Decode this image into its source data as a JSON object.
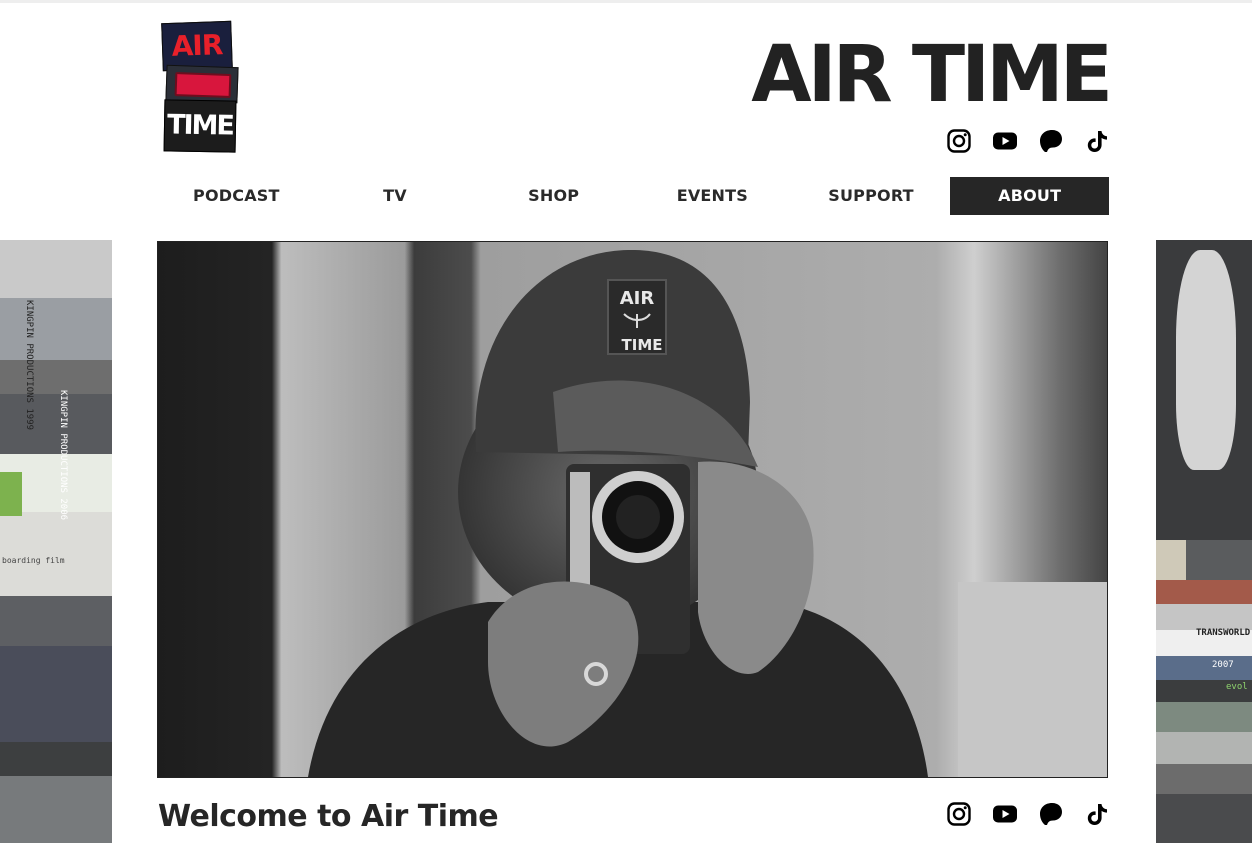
{
  "logo": {
    "line1": "AIR",
    "line2": "TIME"
  },
  "site_title": "AIR TIME",
  "social": [
    {
      "name": "instagram-icon"
    },
    {
      "name": "youtube-icon"
    },
    {
      "name": "patreon-icon"
    },
    {
      "name": "tiktok-icon"
    }
  ],
  "nav": {
    "items": [
      {
        "label": "PODCAST"
      },
      {
        "label": "TV"
      },
      {
        "label": "SHOP"
      },
      {
        "label": "EVENTS"
      },
      {
        "label": "SUPPORT"
      },
      {
        "label": "ABOUT",
        "active": true
      }
    ]
  },
  "hero": {
    "cap_text_line1": "AIR",
    "cap_text_line2": "TIME"
  },
  "welcome_heading": "Welcome to Air Time",
  "side_strips": {
    "left_labels": [
      "KINGPIN PRODUCTIONS 1999",
      "KINGPIN PRODUCTIONS 2006",
      "boarding film"
    ],
    "right_labels": [
      "TRANSWORLD",
      "2007",
      "evol"
    ]
  },
  "colors": {
    "text": "#222222",
    "active_nav_bg": "#262626",
    "logo_red": "#e8202a"
  }
}
